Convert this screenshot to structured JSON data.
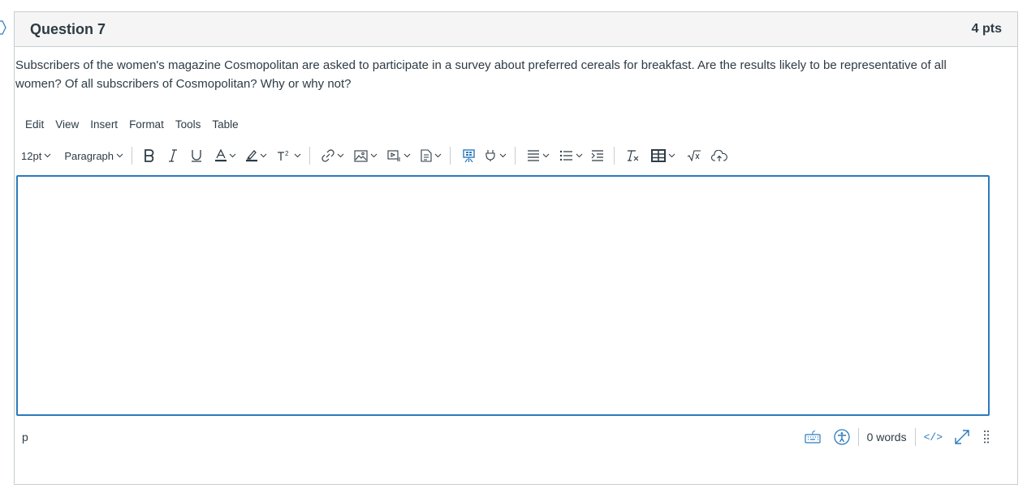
{
  "question": {
    "title": "Question 7",
    "points": "4 pts",
    "text": "Subscribers of the women's magazine Cosmopolitan are asked to participate in a survey about preferred cereals for breakfast. Are the results likely to be representative of all women? Of all subscribers of Cosmopolitan? Why or why not?"
  },
  "editor": {
    "menubar": [
      "Edit",
      "View",
      "Insert",
      "Format",
      "Tools",
      "Table"
    ],
    "font_size": "12pt",
    "block_format": "Paragraph",
    "toolbar_icons": [
      "bold-icon",
      "italic-icon",
      "underline-icon",
      "text-color-icon",
      "highlight-color-icon",
      "superscript-icon",
      "link-icon",
      "image-icon",
      "media-icon",
      "document-icon",
      "apps-icon",
      "plugin-icon",
      "align-icon",
      "list-icon",
      "indent-icon",
      "clear-format-icon",
      "table-icon",
      "equation-icon",
      "cloud-upload-icon"
    ],
    "content": "",
    "status_path": "p",
    "word_count": "0 words",
    "html_toggle": "</>"
  },
  "colors": {
    "accent": "#2b7abc",
    "text": "#2d3b45",
    "border": "#c7cdd1",
    "header_bg": "#f5f5f5"
  }
}
